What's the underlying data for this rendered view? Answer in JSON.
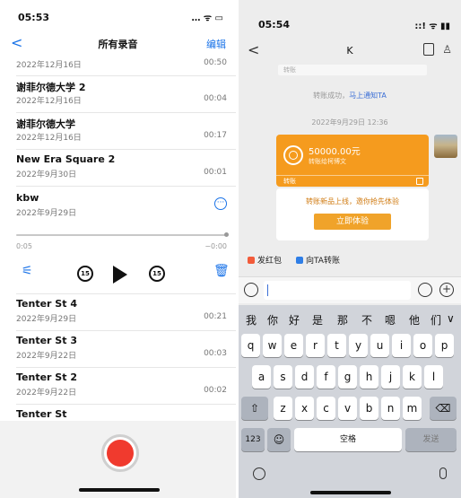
{
  "left": {
    "time": "05:53",
    "status_icons": "… ᯤ ▭",
    "nav": {
      "back": "<",
      "title": "所有录音",
      "edit": "编辑"
    },
    "recordings": [
      {
        "name": "",
        "date": "2022年12月16日",
        "duration": "00:50"
      },
      {
        "name": "谢菲尔德大学 2",
        "date": "2022年12月16日",
        "duration": "00:04"
      },
      {
        "name": "谢菲尔德大学",
        "date": "2022年12月16日",
        "duration": "00:17"
      },
      {
        "name": "New Era Square 2",
        "date": "2022年9月30日",
        "duration": "00:01"
      }
    ],
    "expanded": {
      "name": "kbw",
      "date": "2022年9月29日",
      "more": "···",
      "time_start": "0:05",
      "time_end": "−0:00",
      "progress": 1.0,
      "skip_back": "15",
      "skip_fwd": "15"
    },
    "recordings2": [
      {
        "name": "Tenter St 4",
        "date": "2022年9月29日",
        "duration": "00:21"
      },
      {
        "name": "Tenter St 3",
        "date": "2022年9月22日",
        "duration": "00:03"
      },
      {
        "name": "Tenter St 2",
        "date": "2022年9月22日",
        "duration": "00:02"
      },
      {
        "name": "Tenter St",
        "date": "",
        "duration": ""
      }
    ]
  },
  "right": {
    "time": "05:54",
    "status_icons": "::! ᯤ ▮▮",
    "nav": {
      "back": "<",
      "title": "K"
    },
    "chip_top": "转账",
    "sys_note": "转账成功，",
    "sys_link": "马上通知TA",
    "timestamp": "2022年9月29日 12:36",
    "transfer": {
      "amount": "50000.00元",
      "sub": "转账给柯博文",
      "foot": "转账"
    },
    "promo": {
      "text": "转账新品上线，邀你抢先体验",
      "button": "立即体验"
    },
    "actions": {
      "red_packet": "发红包",
      "transfer_to": "向TA转账"
    },
    "accent": "#f59b1e",
    "keyboard": {
      "candidates": [
        "我",
        "你",
        "好",
        "是",
        "那",
        "不",
        "嗯",
        "他",
        "们",
        "∨"
      ],
      "row1": [
        "q",
        "w",
        "e",
        "r",
        "t",
        "y",
        "u",
        "i",
        "o",
        "p"
      ],
      "row2": [
        "a",
        "s",
        "d",
        "f",
        "g",
        "h",
        "j",
        "k",
        "l"
      ],
      "row3": [
        "z",
        "x",
        "c",
        "v",
        "b",
        "n",
        "m"
      ],
      "shift": "⇧",
      "delete": "⌫",
      "num": "123",
      "emoji": "☺",
      "space": "空格",
      "send": "发送"
    }
  }
}
